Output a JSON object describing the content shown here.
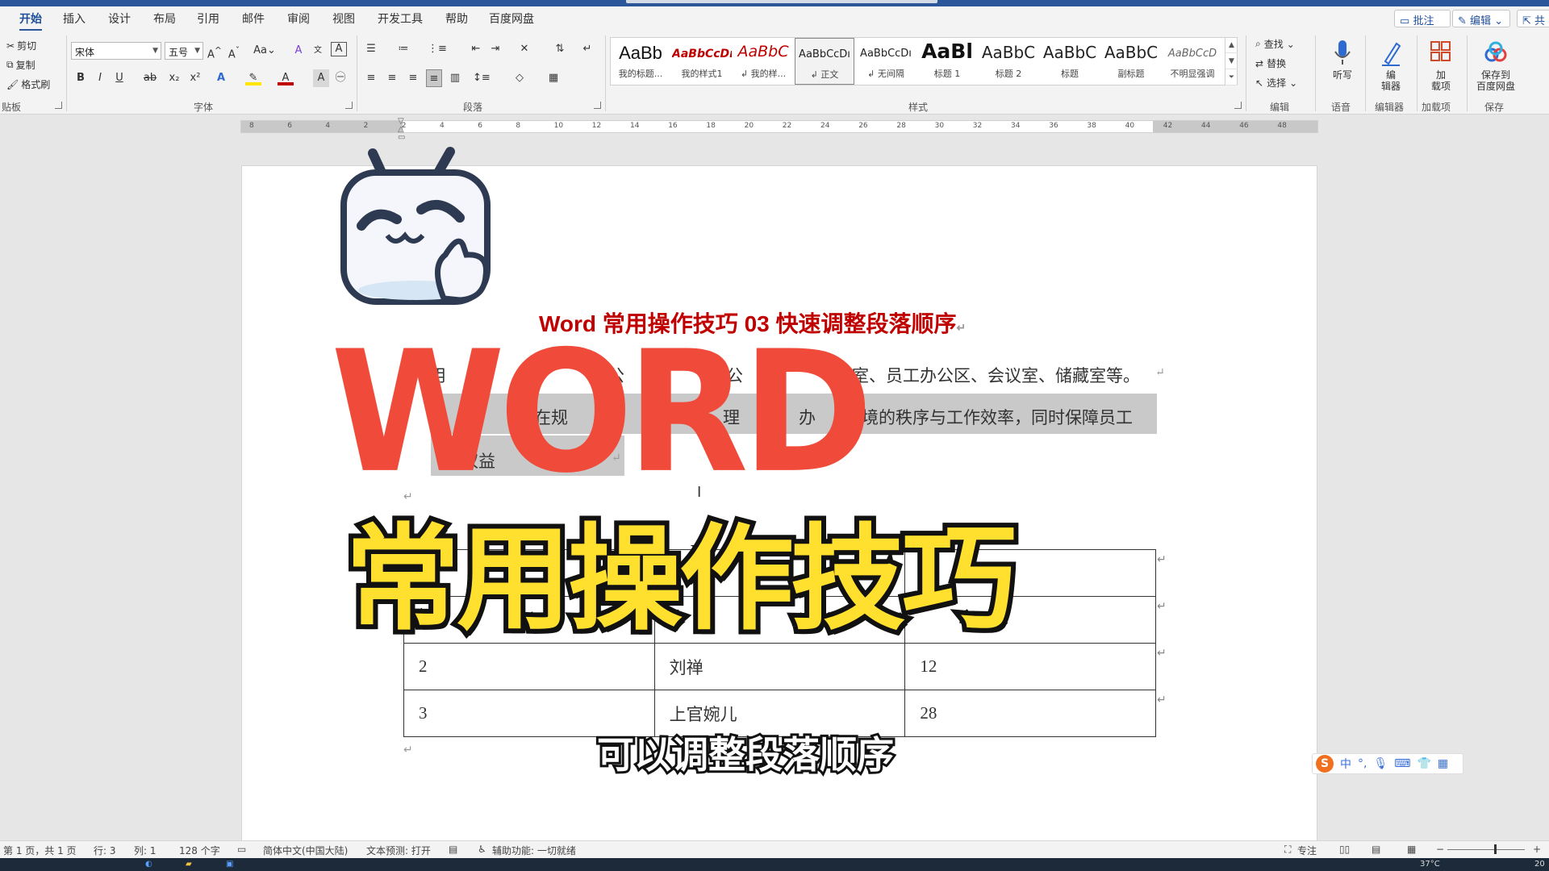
{
  "tabs": [
    "开始",
    "插入",
    "设计",
    "布局",
    "引用",
    "邮件",
    "审阅",
    "视图",
    "开发工具",
    "帮助",
    "百度网盘"
  ],
  "top_buttons": {
    "comment": "批注",
    "edit": "编辑",
    "share": "共"
  },
  "clipboard": {
    "cut": "剪切",
    "copy": "复制",
    "format_painter": "格式刷",
    "group": "贴板"
  },
  "font": {
    "name": "宋体",
    "size": "五号",
    "group": "字体"
  },
  "paragraph_group": "段落",
  "styles": {
    "group": "样式",
    "items": [
      {
        "sample": "AaBb",
        "name": "我的标题..."
      },
      {
        "sample": "AaBbCcDı",
        "name": "我的样式1"
      },
      {
        "sample": "AaBbC",
        "name": "↲ 我的样..."
      },
      {
        "sample": "AaBbCcDı",
        "name": "↲ 正文"
      },
      {
        "sample": "AaBbCcDı",
        "name": "↲ 无间隔"
      },
      {
        "sample": "AaBl",
        "name": "标题 1"
      },
      {
        "sample": "AaBbC",
        "name": "标题 2"
      },
      {
        "sample": "AaBbC",
        "name": "标题"
      },
      {
        "sample": "AaBbC",
        "name": "副标题"
      },
      {
        "sample": "AaBbCcD",
        "name": "不明显强调"
      }
    ]
  },
  "editing": {
    "find": "查找",
    "replace": "替换",
    "select": "选择",
    "group": "编辑"
  },
  "voice": {
    "dictate": "听写",
    "group": "语音"
  },
  "editor": {
    "label": "编\n辑器",
    "group": "编辑器"
  },
  "addins": {
    "label": "加\n载项",
    "group": "加载项"
  },
  "save": {
    "label": "保存到\n百度网盘",
    "group": "保存"
  },
  "ruler_numbers": [
    "8",
    "6",
    "4",
    "2",
    "2",
    "4",
    "6",
    "8",
    "10",
    "12",
    "14",
    "16",
    "18",
    "20",
    "22",
    "24",
    "26",
    "28",
    "30",
    "32",
    "34",
    "36",
    "38",
    "40",
    "42",
    "44",
    "46",
    "48"
  ],
  "document": {
    "title": "Word 常用操作技巧  03  快速调整段落顺序",
    "line1_a": "用",
    "line1_b": "写公",
    "line1_c": "公",
    "line1_d": "室、员工办公区、会议室、储藏室等。",
    "line2_a": "在规",
    "line2_b": "理",
    "line2_c": "办",
    "line2_d": "境的秩序与工作效率，同时保障员工",
    "line3_a": "权益",
    "table_rows": [
      [
        "",
        "",
        ""
      ],
      [
        "",
        "",
        ""
      ],
      [
        "2",
        "刘禅",
        "12"
      ],
      [
        "3",
        "上官婉儿",
        "28"
      ]
    ]
  },
  "overlay": {
    "headline": "WORD",
    "subheadline": "常用操作技巧",
    "subtitle": "可以调整段落顺序"
  },
  "ime": {
    "mode": "中"
  },
  "status": {
    "page": "第 1 页，共 1 页",
    "line": "行: 3",
    "col": "列: 1",
    "words": "128 个字",
    "language": "简体中文(中国大陆)",
    "predict": "文本预测: 打开",
    "accessibility": "辅助功能: 一切就绪",
    "focus": "专注"
  },
  "taskbar": {
    "temp": "37°C",
    "clock": "20"
  },
  "colors": {
    "accent": "#2b579a",
    "title_red": "#c00000",
    "word_red": "#f04b3a",
    "tips_yellow": "#ffe02e"
  }
}
